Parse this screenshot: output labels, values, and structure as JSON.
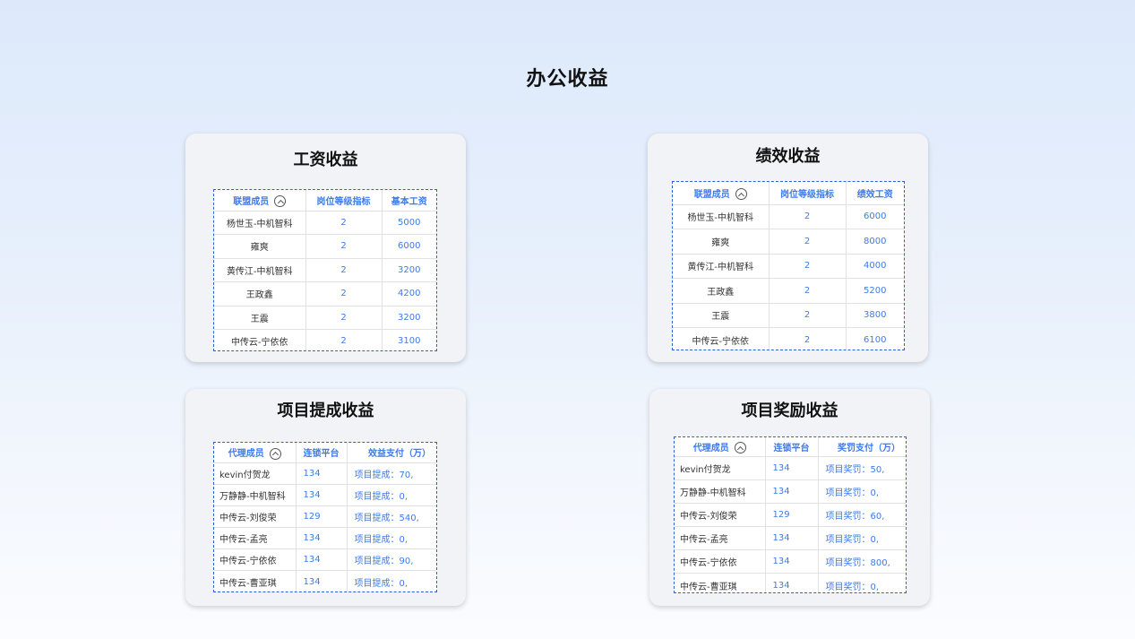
{
  "title": "办公收益",
  "cards": [
    {
      "title": "工资收益",
      "headers": [
        "联盟成员",
        "岗位等级指标",
        "基本工资"
      ],
      "rows": [
        [
          "杨世玉-中机智科",
          "2",
          "5000"
        ],
        [
          "雍爽",
          "2",
          "6000"
        ],
        [
          "黄传江-中机智科",
          "2",
          "3200"
        ],
        [
          "王政鑫",
          "2",
          "4200"
        ],
        [
          "王震",
          "2",
          "3200"
        ],
        [
          "中传云-宁依依",
          "2",
          "3100"
        ]
      ]
    },
    {
      "title": "绩效收益",
      "headers": [
        "联盟成员",
        "岗位等级指标",
        "绩效工资"
      ],
      "rows": [
        [
          "杨世玉-中机智科",
          "2",
          "6000"
        ],
        [
          "雍爽",
          "2",
          "8000"
        ],
        [
          "黄传江-中机智科",
          "2",
          "4000"
        ],
        [
          "王政鑫",
          "2",
          "5200"
        ],
        [
          "王震",
          "2",
          "3800"
        ],
        [
          "中传云-宁依依",
          "2",
          "6100"
        ]
      ]
    },
    {
      "title": "项目提成收益",
      "headers": [
        "代理成员",
        "连锁平台",
        "效益支付（万）"
      ],
      "rows": [
        [
          "kevin付贺龙",
          "134",
          "项目提成：70,"
        ],
        [
          "万静静-中机智科",
          "134",
          "项目提成：0,"
        ],
        [
          "中传云-刘俊荣",
          "129",
          "项目提成：540,"
        ],
        [
          "中传云-孟亮",
          "134",
          "项目提成：0,"
        ],
        [
          "中传云-宁依依",
          "134",
          "项目提成：90,"
        ],
        [
          "中传云-曹亚琪",
          "134",
          "项目提成：0,"
        ]
      ]
    },
    {
      "title": "项目奖励收益",
      "headers": [
        "代理成员",
        "连锁平台",
        "奖罚支付（万）"
      ],
      "rows": [
        [
          "kevin付贺龙",
          "134",
          "项目奖罚：50,"
        ],
        [
          "万静静-中机智科",
          "134",
          "项目奖罚：0,"
        ],
        [
          "中传云-刘俊荣",
          "129",
          "项目奖罚：60,"
        ],
        [
          "中传云-孟亮",
          "134",
          "项目奖罚：0,"
        ],
        [
          "中传云-宁依依",
          "134",
          "项目奖罚：800,"
        ],
        [
          "中传云-曹亚琪",
          "134",
          "项目奖罚：0,"
        ]
      ]
    }
  ]
}
